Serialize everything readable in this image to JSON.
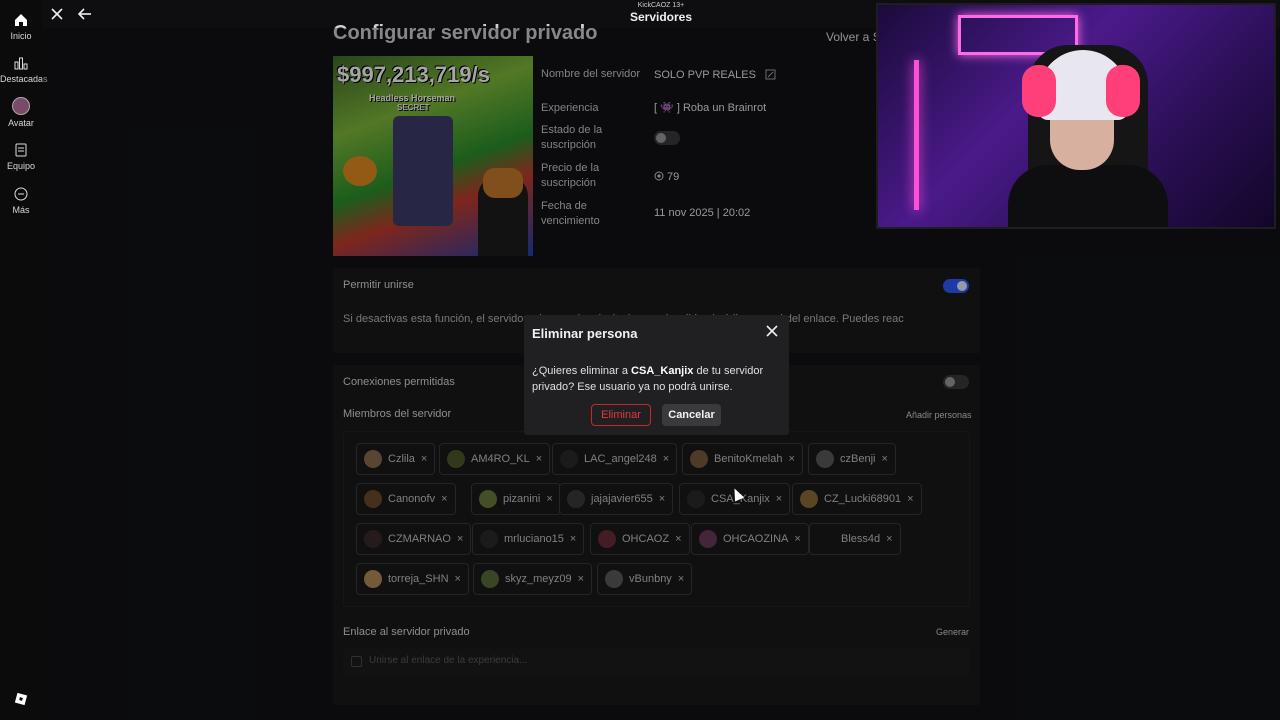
{
  "window": {
    "app_small_title": "KickCAOZ 13+",
    "title": "Servidores"
  },
  "sidebar": {
    "items": [
      {
        "label": "Inicio"
      },
      {
        "label": "Destacadas"
      },
      {
        "label": "Avatar"
      },
      {
        "label": "Equipo"
      },
      {
        "label": "Más"
      }
    ]
  },
  "page": {
    "title": "Configurar servidor privado",
    "back_link": "Volver a S"
  },
  "thumbnail": {
    "money_text": "$997,213,719/s",
    "label1": "Headless Horseman",
    "label2": "SECRET"
  },
  "info": {
    "server_name_label": "Nombre del servidor",
    "server_name_value": "SOLO PVP REALES",
    "experience_label": "Experiencia",
    "experience_value": "[ 👾 ] Roba un Brainrot",
    "subscription_state_label": "Estado de la suscripción",
    "subscription_state_on": false,
    "subscription_price_label": "Precio de la suscripción",
    "subscription_price_value": "79",
    "expiry_label": "Fecha de vencimiento",
    "expiry_value": "11 nov 2025 | 20:02"
  },
  "allow_join": {
    "title": "Permitir unirse",
    "on": true,
    "description": "Si desactivas esta función, el servidor                                                                                   a las que has invitado, y se invalida el código actual del enlace. Puedes reac"
  },
  "connections": {
    "title": "Conexiones permitidas",
    "on": false
  },
  "members": {
    "title": "Miembros del servidor",
    "add_button": "Añadir personas",
    "list": [
      {
        "name": "Czlila"
      },
      {
        "name": "AM4RO_KL"
      },
      {
        "name": "LAC_angel248"
      },
      {
        "name": "BenitoKmelah"
      },
      {
        "name": "czBenji"
      },
      {
        "name": "Canonofv"
      },
      {
        "name": "pizanini"
      },
      {
        "name": "jajajavier655"
      },
      {
        "name": "CSA_Kanjix"
      },
      {
        "name": "CZ_Lucki68901"
      },
      {
        "name": "CZMARNAO"
      },
      {
        "name": "mrluciano15"
      },
      {
        "name": "OHCAOZ"
      },
      {
        "name": "OHCAOZINA"
      },
      {
        "name": "Bless4d"
      },
      {
        "name": "torreja_SHN"
      },
      {
        "name": "skyz_meyz09"
      },
      {
        "name": "vBunbny"
      }
    ]
  },
  "private_link": {
    "title": "Enlace al servidor privado",
    "generate_button": "Generar",
    "placeholder": "Unirse al enlace de la experiencia..."
  },
  "modal": {
    "title": "Eliminar persona",
    "body_prefix": "¿Quieres eliminar a ",
    "body_user": "CSA_Kanjix",
    "body_suffix": " de tu servidor privado? Ese usuario ya no podrá unirse.",
    "delete_button": "Eliminar",
    "cancel_button": "Cancelar"
  },
  "colors": {
    "accent_blue": "#2d5bff",
    "danger_red": "#e23a3a",
    "background": "#111214"
  },
  "icons": [
    "home-icon",
    "chart-icon",
    "avatar-icon",
    "team-icon",
    "more-icon",
    "close-icon",
    "back-arrow-icon",
    "edit-icon",
    "robux-icon",
    "link-icon",
    "roblox-logo-icon"
  ]
}
